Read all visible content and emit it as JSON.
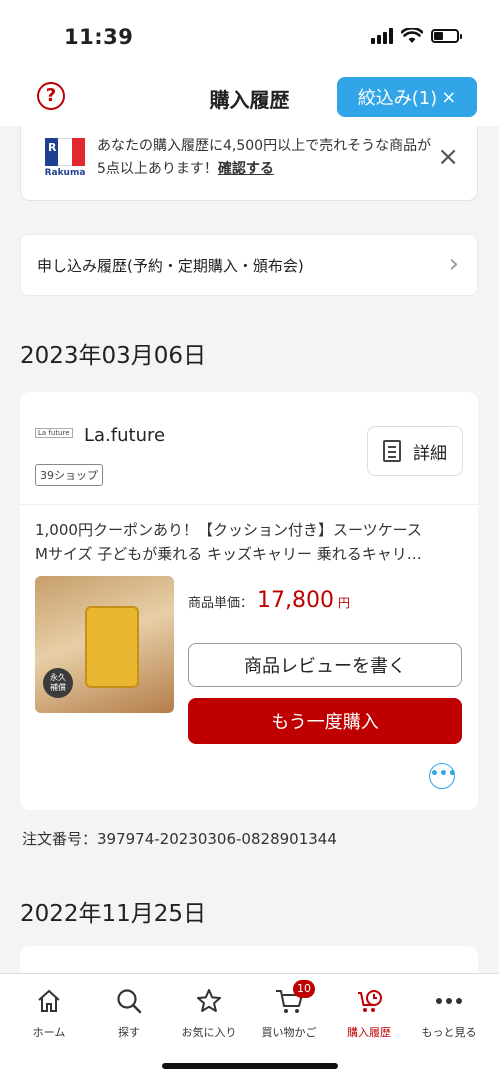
{
  "status_bar": {
    "time": "11:39"
  },
  "header": {
    "help_icon": "question-circle-icon",
    "title": "購入履歴",
    "filter_label": "絞込み(1)",
    "filter_close": "×"
  },
  "notice": {
    "logo_text": "Rakuma",
    "text": "あなたの購入履歴に4,500円以上で売れそうな商品が5点以上あります！",
    "link": "確認する",
    "close": "×"
  },
  "apply_history": {
    "label": "申し込み履歴(予約・定期購入・頒布会)",
    "chevron": "›"
  },
  "orders": [
    {
      "date": "2023年03月06日",
      "shop_logo_text": "La future",
      "shop_name": "La.future",
      "shop_badge": "39ショップ",
      "detail_label": "詳細",
      "product_title_line1": "1,000円クーポンあり！【クッション付き】スーツケース",
      "product_title_line2": "Mサイズ 子どもが乗れる キッズキャリー 乗れるキャリ…",
      "price_label": "商品単価：",
      "price_value": "17,800",
      "price_unit": "円",
      "review_label": "商品レビューを書く",
      "rebuy_label": "もう一度購入",
      "more_label": "•••",
      "order_number": "注文番号：397974-20230306-0828901344"
    },
    {
      "date": "2022年11月25日"
    }
  ],
  "tabs": [
    {
      "label": "ホーム",
      "icon": "home-icon"
    },
    {
      "label": "探す",
      "icon": "search-icon"
    },
    {
      "label": "お気に入り",
      "icon": "star-icon"
    },
    {
      "label": "買い物かご",
      "icon": "cart-icon",
      "badge": "10"
    },
    {
      "label": "購入履歴",
      "icon": "history-icon",
      "active": true
    },
    {
      "label": "もっと見る",
      "icon": "more-icon"
    }
  ],
  "colors": {
    "accent_red": "#bf0000",
    "filter_blue": "#31a5e8"
  }
}
